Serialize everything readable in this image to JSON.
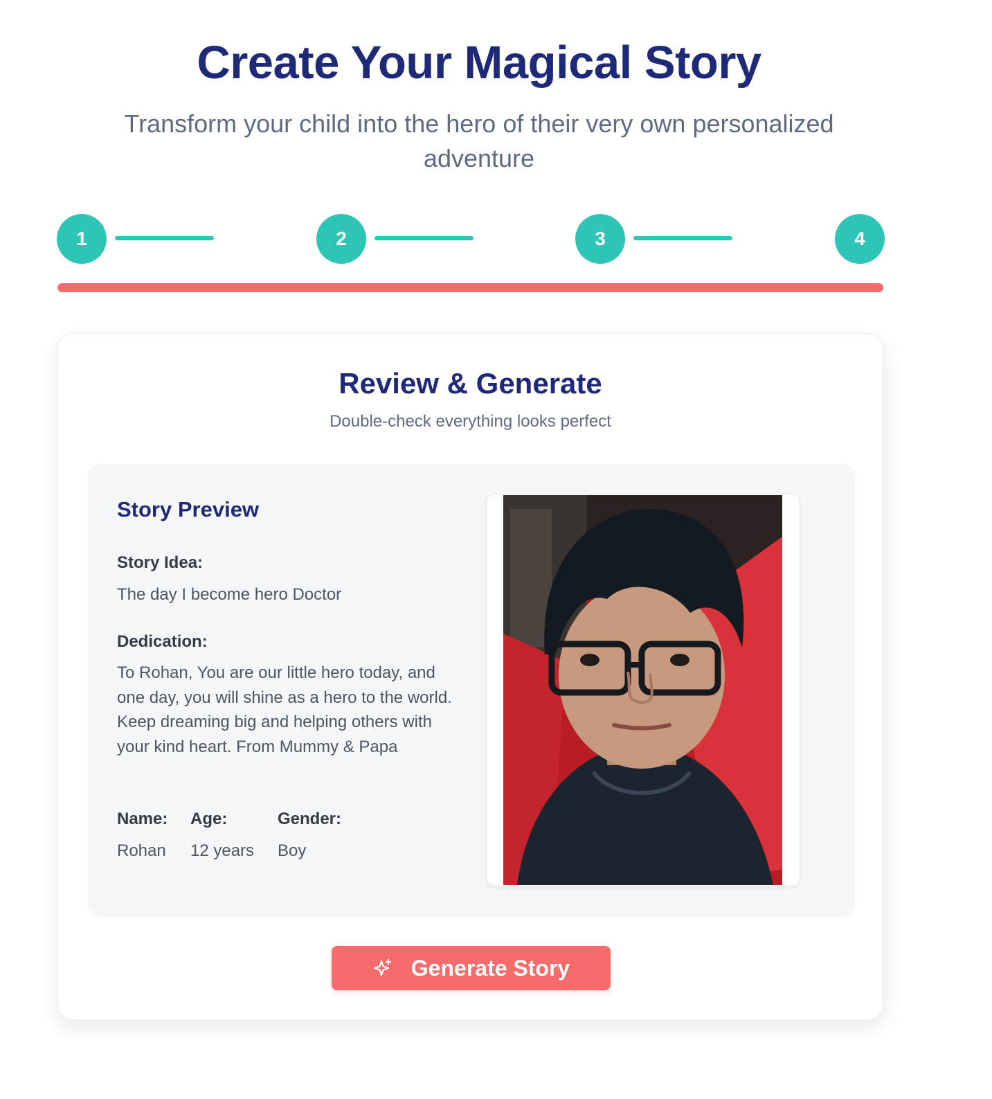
{
  "header": {
    "title": "Create Your Magical Story",
    "subtitle": "Transform your child into the hero of their very own personalized adventure"
  },
  "stepper": {
    "steps": [
      "1",
      "2",
      "3",
      "4"
    ],
    "accent_color": "#2ec4b6",
    "progress_color": "#f76b6b",
    "progress_fraction": 1.0
  },
  "review": {
    "title": "Review & Generate",
    "subtitle": "Double-check everything looks perfect"
  },
  "preview": {
    "heading": "Story Preview",
    "story_idea_label": "Story Idea:",
    "story_idea": "The day I become hero Doctor",
    "dedication_label": "Dedication:",
    "dedication": "To Rohan, You are our little hero today, and one day, you will shine as a hero to the world. Keep dreaming big and helping others with your kind heart. From Mummy & Papa",
    "name_label": "Name:",
    "name": "Rohan",
    "age_label": "Age:",
    "age": "12 years",
    "gender_label": "Gender:",
    "gender": "Boy"
  },
  "actions": {
    "generate_label": "Generate Story",
    "generate_icon": "sparkle-icon"
  }
}
